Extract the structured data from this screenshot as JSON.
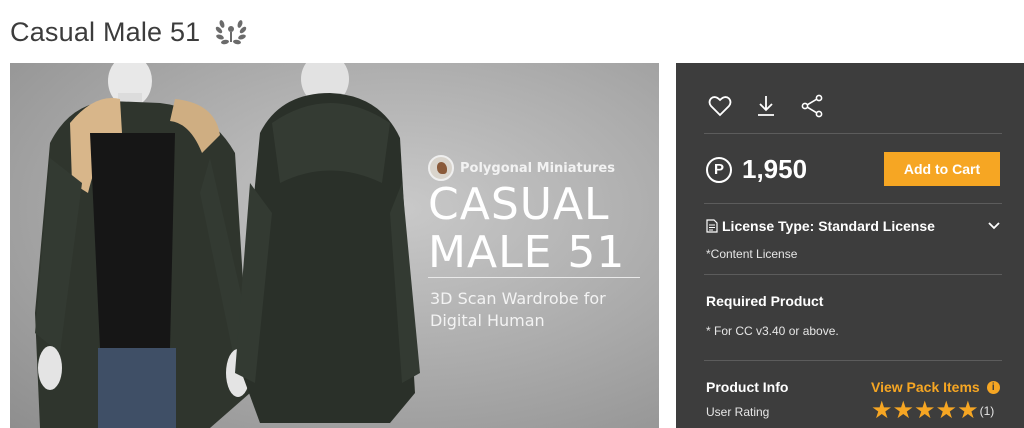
{
  "page": {
    "title": "Casual Male 51",
    "badge_icon": "laurel-wreath-icon"
  },
  "hero": {
    "brand": "Polygonal Miniatures",
    "heading_line1": "CASUAL",
    "heading_line2": "MALE 51",
    "sub_line1": "3D Scan Wardrobe for",
    "sub_line2": "Digital Human"
  },
  "panel": {
    "actions": [
      {
        "name": "heart-icon"
      },
      {
        "name": "download-icon"
      },
      {
        "name": "share-icon"
      }
    ],
    "currency_symbol": "P",
    "price": "1,950",
    "add_to_cart": "Add to Cart",
    "license_label": "License Type: Standard License",
    "license_note": "*Content License",
    "required_title": "Required Product",
    "required_note": "* For CC v3.40 or above.",
    "info_title": "Product Info",
    "view_pack": "View Pack Items",
    "rating_label": "User Rating",
    "rating_stars": 5,
    "rating_count": "(1)"
  },
  "colors": {
    "accent": "#f6a623",
    "panel_bg": "#3d3d3d"
  }
}
